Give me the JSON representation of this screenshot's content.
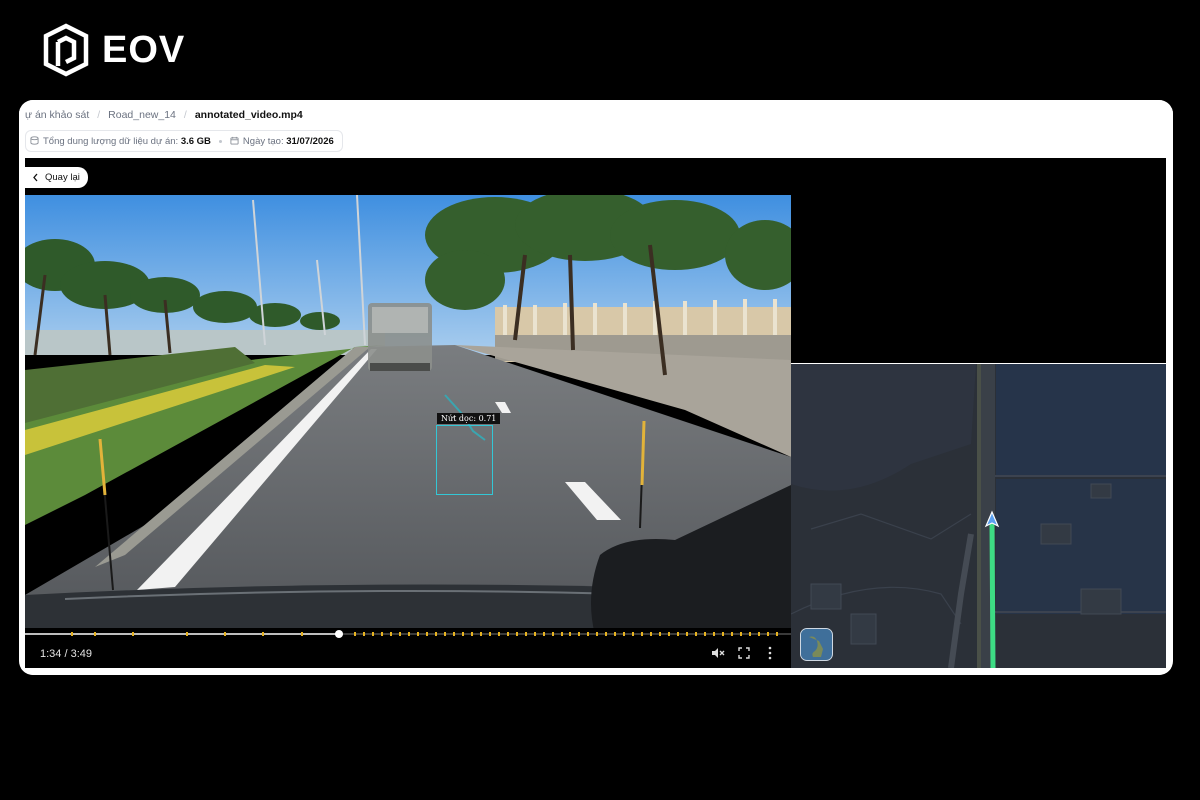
{
  "brand": {
    "name": "EOV"
  },
  "breadcrumb": {
    "items": [
      "ự án khảo sát",
      "Road_new_14",
      "annotated_video.mp4"
    ],
    "separator": "/"
  },
  "project_stats": {
    "storage_label": "Tổng dung lượng dữ liệu dự án:",
    "storage_value": "3.6 GB",
    "created_label": "Ngày tạo:",
    "created_value": "31/07/2026"
  },
  "video": {
    "back_label": "Quay lại",
    "detection_label": "Nứt dọc: 0.71",
    "current_time": "1:34",
    "duration": "3:49",
    "time_display": "1:34 / 3:49",
    "progress": 0.41,
    "controls": [
      "mute-icon",
      "fullscreen-icon",
      "more-options-icon"
    ]
  },
  "map": {
    "route_color": "#3ddc84",
    "marker_icon": "navigation-arrow-icon",
    "thumbnail_icon": "map-layer-icon"
  },
  "colors": {
    "detection_box": "#33c7d6",
    "timeline_markers": "#e8b320",
    "map_background": "#2b3038"
  }
}
